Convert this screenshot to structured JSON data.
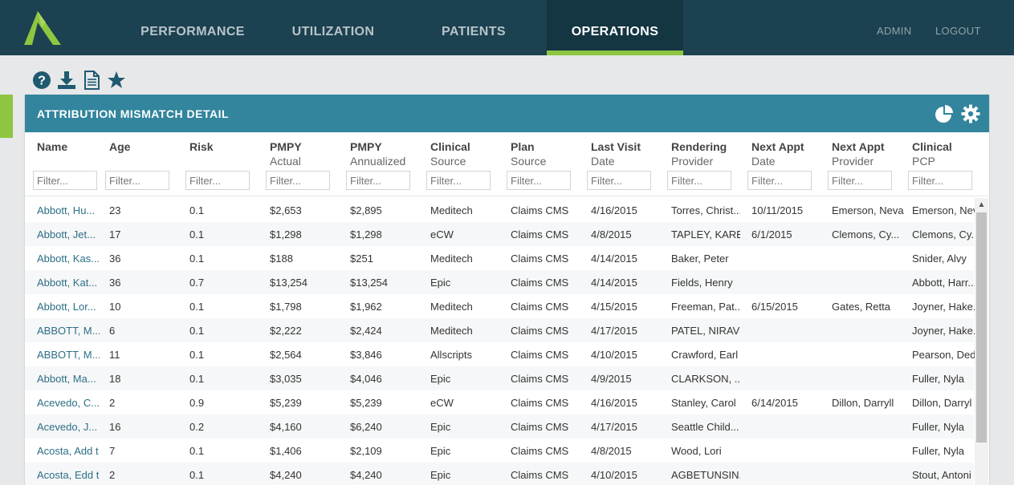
{
  "nav": {
    "logo_icon": "peak-logo-icon",
    "tabs": [
      "PERFORMANCE",
      "UTILIZATION",
      "PATIENTS",
      "OPERATIONS"
    ],
    "active_tab": "OPERATIONS",
    "right_links": [
      "ADMIN",
      "LOGOUT"
    ]
  },
  "toolbar": {
    "icons": [
      "help-icon",
      "download-icon",
      "document-icon",
      "star-icon"
    ]
  },
  "panel": {
    "title": "ATTRIBUTION MISMATCH DETAIL",
    "header_icons": [
      "pie-chart-icon",
      "gear-icon"
    ],
    "columns": [
      {
        "line1": "Name",
        "line2": ""
      },
      {
        "line1": "Age",
        "line2": ""
      },
      {
        "line1": "Risk",
        "line2": ""
      },
      {
        "line1": "PMPY",
        "line2": "Actual"
      },
      {
        "line1": "PMPY",
        "line2": "Annualized"
      },
      {
        "line1": "Clinical",
        "line2": "Source"
      },
      {
        "line1": "Plan",
        "line2": "Source"
      },
      {
        "line1": "Last Visit",
        "line2": "Date"
      },
      {
        "line1": "Rendering",
        "line2": "Provider"
      },
      {
        "line1": "Next Appt",
        "line2": "Date"
      },
      {
        "line1": "Next Appt",
        "line2": "Provider"
      },
      {
        "line1": "Clinical",
        "line2": "PCP"
      }
    ],
    "filter_placeholder": "Filter...",
    "rows": [
      [
        "Abbott, Hu...",
        "23",
        "0.1",
        "$2,653",
        "$2,895",
        "Meditech",
        "Claims CMS",
        "4/16/2015",
        "Torres, Christ...",
        "10/11/2015",
        "Emerson, Neva",
        "Emerson, Nev"
      ],
      [
        "Abbott, Jet...",
        "17",
        "0.1",
        "$1,298",
        "$1,298",
        "eCW",
        "Claims CMS",
        "4/8/2015",
        "TAPLEY, KAREN",
        "6/1/2015",
        "Clemons, Cy...",
        "Clemons, Cy..."
      ],
      [
        "Abbott, Kas...",
        "36",
        "0.1",
        "$188",
        "$251",
        "Meditech",
        "Claims CMS",
        "4/14/2015",
        "Baker, Peter",
        "",
        "",
        "Snider, Alvy"
      ],
      [
        "Abbott, Kat...",
        "36",
        "0.7",
        "$13,254",
        "$13,254",
        "Epic",
        "Claims CMS",
        "4/14/2015",
        "Fields, Henry",
        "",
        "",
        "Abbott, Harr..."
      ],
      [
        "Abbott, Lor...",
        "10",
        "0.1",
        "$1,798",
        "$1,962",
        "Meditech",
        "Claims CMS",
        "4/15/2015",
        "Freeman, Pat...",
        "6/15/2015",
        "Gates, Retta",
        "Joyner, Hake..."
      ],
      [
        "ABBOTT, M...",
        "6",
        "0.1",
        "$2,222",
        "$2,424",
        "Meditech",
        "Claims CMS",
        "4/17/2015",
        "PATEL, NIRAV",
        "",
        "",
        "Joyner, Hake..."
      ],
      [
        "ABBOTT, M...",
        "11",
        "0.1",
        "$2,564",
        "$3,846",
        "Allscripts",
        "Claims CMS",
        "4/10/2015",
        "Crawford, Earl",
        "",
        "",
        "Pearson, Ded"
      ],
      [
        "Abbott, Ma...",
        "18",
        "0.1",
        "$3,035",
        "$4,046",
        "Epic",
        "Claims CMS",
        "4/9/2015",
        "CLARKSON, ...",
        "",
        "",
        "Fuller, Nyla"
      ],
      [
        "Acevedo, C...",
        "2",
        "0.9",
        "$5,239",
        "$5,239",
        "eCW",
        "Claims CMS",
        "4/16/2015",
        "Stanley, Carol",
        "6/14/2015",
        "Dillon, Darryll",
        "Dillon, Darryl"
      ],
      [
        "Acevedo, J...",
        "16",
        "0.2",
        "$4,160",
        "$6,240",
        "Epic",
        "Claims CMS",
        "4/17/2015",
        "Seattle Child...",
        "",
        "",
        "Fuller, Nyla"
      ],
      [
        "Acosta, Add t",
        "7",
        "0.1",
        "$1,406",
        "$2,109",
        "Epic",
        "Claims CMS",
        "4/8/2015",
        "Wood, Lori",
        "",
        "",
        "Fuller, Nyla"
      ],
      [
        "Acosta, Edd t",
        "2",
        "0.1",
        "$4,240",
        "$4,240",
        "Epic",
        "Claims CMS",
        "4/10/2015",
        "AGBETUNSIN...",
        "",
        "",
        "Stout, Antoni"
      ]
    ]
  },
  "colors": {
    "nav_bg": "#1c4150",
    "accent_green": "#8ec641",
    "panel_header": "#32859d",
    "link": "#2c6f86"
  }
}
